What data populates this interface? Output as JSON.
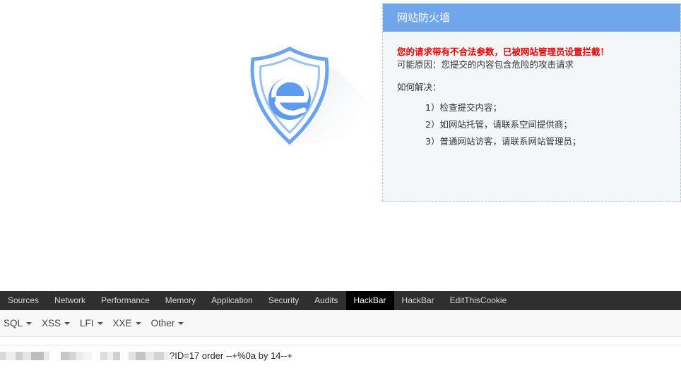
{
  "waf": {
    "title": "网站防火墙",
    "alert": "您的请求带有不合法参数，已被网站管理员设置拦截！",
    "reason": "可能原因：您提交的内容包含危险的攻击请求",
    "howto": "如何解决：",
    "steps": [
      "1）检查提交内容；",
      "2）如网站托管，请联系空间提供商；",
      "3）普通网站访客，请联系网站管理员；"
    ],
    "colors": {
      "header": "#70a6ec",
      "alert": "#ee0000",
      "panel_bg": "#f3f7fa"
    },
    "logo_icon": "shield-e-icon"
  },
  "devtools": {
    "tabs": [
      "Sources",
      "Network",
      "Performance",
      "Memory",
      "Application",
      "Security",
      "Audits",
      "HackBar",
      "HackBar",
      "EditThisCookie"
    ],
    "active_tab": "HackBar"
  },
  "hackbar": {
    "menu": [
      "SQL",
      "XSS",
      "LFI",
      "XXE",
      "Other"
    ],
    "url_suffix": "?ID=17 order --+%0a by 14--+"
  }
}
